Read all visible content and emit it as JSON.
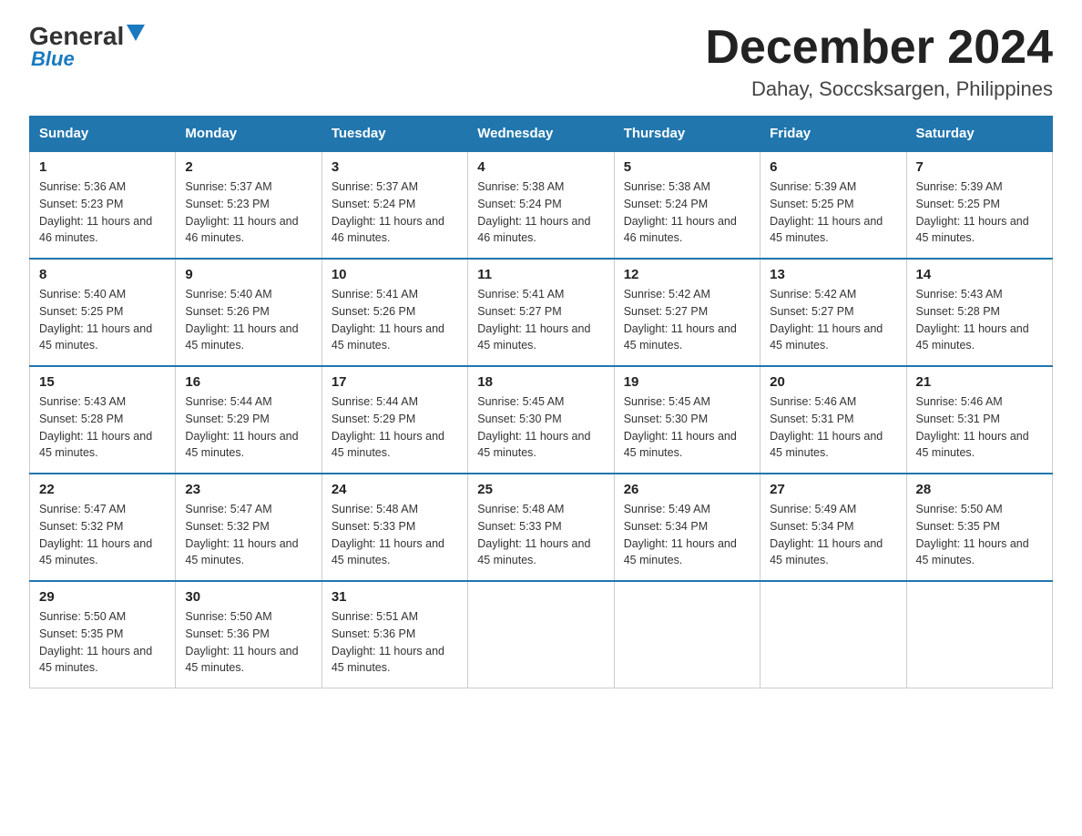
{
  "logo": {
    "general": "General",
    "blue": "Blue"
  },
  "title": "December 2024",
  "subtitle": "Dahay, Soccsksargen, Philippines",
  "days_of_week": [
    "Sunday",
    "Monday",
    "Tuesday",
    "Wednesday",
    "Thursday",
    "Friday",
    "Saturday"
  ],
  "weeks": [
    [
      {
        "num": "1",
        "sunrise": "5:36 AM",
        "sunset": "5:23 PM",
        "daylight": "11 hours and 46 minutes."
      },
      {
        "num": "2",
        "sunrise": "5:37 AM",
        "sunset": "5:23 PM",
        "daylight": "11 hours and 46 minutes."
      },
      {
        "num": "3",
        "sunrise": "5:37 AM",
        "sunset": "5:24 PM",
        "daylight": "11 hours and 46 minutes."
      },
      {
        "num": "4",
        "sunrise": "5:38 AM",
        "sunset": "5:24 PM",
        "daylight": "11 hours and 46 minutes."
      },
      {
        "num": "5",
        "sunrise": "5:38 AM",
        "sunset": "5:24 PM",
        "daylight": "11 hours and 46 minutes."
      },
      {
        "num": "6",
        "sunrise": "5:39 AM",
        "sunset": "5:25 PM",
        "daylight": "11 hours and 45 minutes."
      },
      {
        "num": "7",
        "sunrise": "5:39 AM",
        "sunset": "5:25 PM",
        "daylight": "11 hours and 45 minutes."
      }
    ],
    [
      {
        "num": "8",
        "sunrise": "5:40 AM",
        "sunset": "5:25 PM",
        "daylight": "11 hours and 45 minutes."
      },
      {
        "num": "9",
        "sunrise": "5:40 AM",
        "sunset": "5:26 PM",
        "daylight": "11 hours and 45 minutes."
      },
      {
        "num": "10",
        "sunrise": "5:41 AM",
        "sunset": "5:26 PM",
        "daylight": "11 hours and 45 minutes."
      },
      {
        "num": "11",
        "sunrise": "5:41 AM",
        "sunset": "5:27 PM",
        "daylight": "11 hours and 45 minutes."
      },
      {
        "num": "12",
        "sunrise": "5:42 AM",
        "sunset": "5:27 PM",
        "daylight": "11 hours and 45 minutes."
      },
      {
        "num": "13",
        "sunrise": "5:42 AM",
        "sunset": "5:27 PM",
        "daylight": "11 hours and 45 minutes."
      },
      {
        "num": "14",
        "sunrise": "5:43 AM",
        "sunset": "5:28 PM",
        "daylight": "11 hours and 45 minutes."
      }
    ],
    [
      {
        "num": "15",
        "sunrise": "5:43 AM",
        "sunset": "5:28 PM",
        "daylight": "11 hours and 45 minutes."
      },
      {
        "num": "16",
        "sunrise": "5:44 AM",
        "sunset": "5:29 PM",
        "daylight": "11 hours and 45 minutes."
      },
      {
        "num": "17",
        "sunrise": "5:44 AM",
        "sunset": "5:29 PM",
        "daylight": "11 hours and 45 minutes."
      },
      {
        "num": "18",
        "sunrise": "5:45 AM",
        "sunset": "5:30 PM",
        "daylight": "11 hours and 45 minutes."
      },
      {
        "num": "19",
        "sunrise": "5:45 AM",
        "sunset": "5:30 PM",
        "daylight": "11 hours and 45 minutes."
      },
      {
        "num": "20",
        "sunrise": "5:46 AM",
        "sunset": "5:31 PM",
        "daylight": "11 hours and 45 minutes."
      },
      {
        "num": "21",
        "sunrise": "5:46 AM",
        "sunset": "5:31 PM",
        "daylight": "11 hours and 45 minutes."
      }
    ],
    [
      {
        "num": "22",
        "sunrise": "5:47 AM",
        "sunset": "5:32 PM",
        "daylight": "11 hours and 45 minutes."
      },
      {
        "num": "23",
        "sunrise": "5:47 AM",
        "sunset": "5:32 PM",
        "daylight": "11 hours and 45 minutes."
      },
      {
        "num": "24",
        "sunrise": "5:48 AM",
        "sunset": "5:33 PM",
        "daylight": "11 hours and 45 minutes."
      },
      {
        "num": "25",
        "sunrise": "5:48 AM",
        "sunset": "5:33 PM",
        "daylight": "11 hours and 45 minutes."
      },
      {
        "num": "26",
        "sunrise": "5:49 AM",
        "sunset": "5:34 PM",
        "daylight": "11 hours and 45 minutes."
      },
      {
        "num": "27",
        "sunrise": "5:49 AM",
        "sunset": "5:34 PM",
        "daylight": "11 hours and 45 minutes."
      },
      {
        "num": "28",
        "sunrise": "5:50 AM",
        "sunset": "5:35 PM",
        "daylight": "11 hours and 45 minutes."
      }
    ],
    [
      {
        "num": "29",
        "sunrise": "5:50 AM",
        "sunset": "5:35 PM",
        "daylight": "11 hours and 45 minutes."
      },
      {
        "num": "30",
        "sunrise": "5:50 AM",
        "sunset": "5:36 PM",
        "daylight": "11 hours and 45 minutes."
      },
      {
        "num": "31",
        "sunrise": "5:51 AM",
        "sunset": "5:36 PM",
        "daylight": "11 hours and 45 minutes."
      },
      null,
      null,
      null,
      null
    ]
  ]
}
